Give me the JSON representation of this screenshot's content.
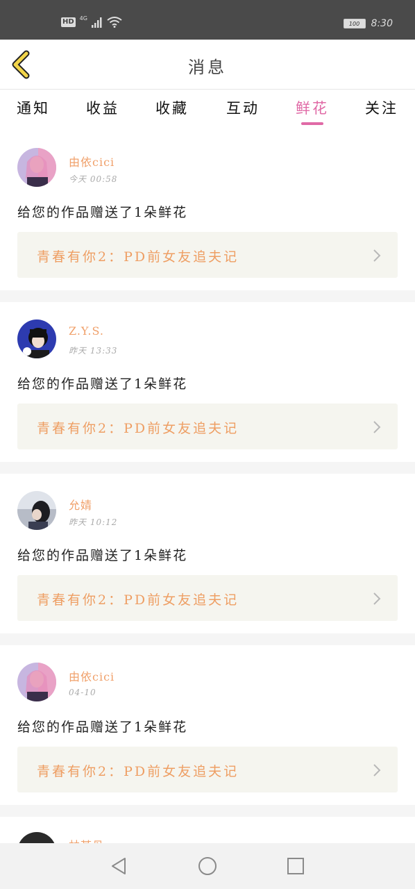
{
  "status_bar": {
    "hd": "HD",
    "network": "4G",
    "battery": "100",
    "time": "8:30"
  },
  "header": {
    "title": "消息",
    "back_icon": "back-chevron-icon",
    "accent_color": "#f2d54a"
  },
  "tabs": [
    {
      "label": "通知",
      "active": false
    },
    {
      "label": "收益",
      "active": false
    },
    {
      "label": "收藏",
      "active": false
    },
    {
      "label": "互动",
      "active": false
    },
    {
      "label": "鲜花",
      "active": true
    },
    {
      "label": "关注",
      "active": false
    }
  ],
  "active_color": "#e06aa6",
  "messages": [
    {
      "username": "由依cici",
      "time": "今天 00:58",
      "text": "给您的作品赠送了1朵鲜花",
      "work_title": "青春有你2：PD前女友追夫记"
    },
    {
      "username": "Z.Y.S.",
      "time": "昨天 13:33",
      "text": "给您的作品赠送了1朵鲜花",
      "work_title": "青春有你2：PD前女友追夫记"
    },
    {
      "username": "允婧",
      "time": "昨天 10:12",
      "text": "给您的作品赠送了1朵鲜花",
      "work_title": "青春有你2：PD前女友追夫记"
    },
    {
      "username": "由依cici",
      "time": "04-10",
      "text": "给您的作品赠送了1朵鲜花",
      "work_title": "青春有你2：PD前女友追夫记"
    }
  ],
  "partial_message": {
    "username": "林某丹"
  },
  "nav": {
    "back": "nav-back-icon",
    "home": "nav-home-icon",
    "recents": "nav-recents-icon"
  }
}
